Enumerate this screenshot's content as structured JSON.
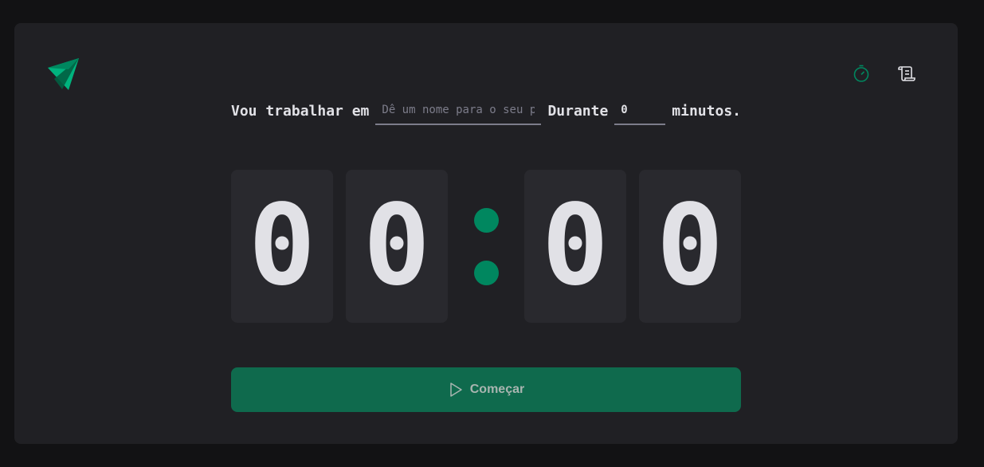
{
  "header": {
    "logo_icon": "triangle-play-logo-icon",
    "nav": [
      {
        "icon": "timer-icon",
        "active": true,
        "color": "#00875f"
      },
      {
        "icon": "scroll-history-icon",
        "active": false,
        "color": "#e1e1e6"
      }
    ]
  },
  "form": {
    "task_label": "Vou trabalhar em",
    "task_placeholder": "Dê um nome para o seu projeto",
    "duration_label": "Durante",
    "minutes_value": "0",
    "minutes_suffix": "minutos."
  },
  "countdown": {
    "minutes_tens": "0",
    "minutes_ones": "0",
    "separator": ":",
    "seconds_tens": "0",
    "seconds_ones": "0"
  },
  "start_button": {
    "label": "Começar",
    "icon": "play-icon"
  },
  "colors": {
    "background": "#121214",
    "panel": "#202024",
    "digit_bg": "#29292e",
    "accent": "#00875f",
    "button_bg": "#0f6a4d",
    "text": "#e1e1e6",
    "placeholder": "#7c7c8a"
  }
}
